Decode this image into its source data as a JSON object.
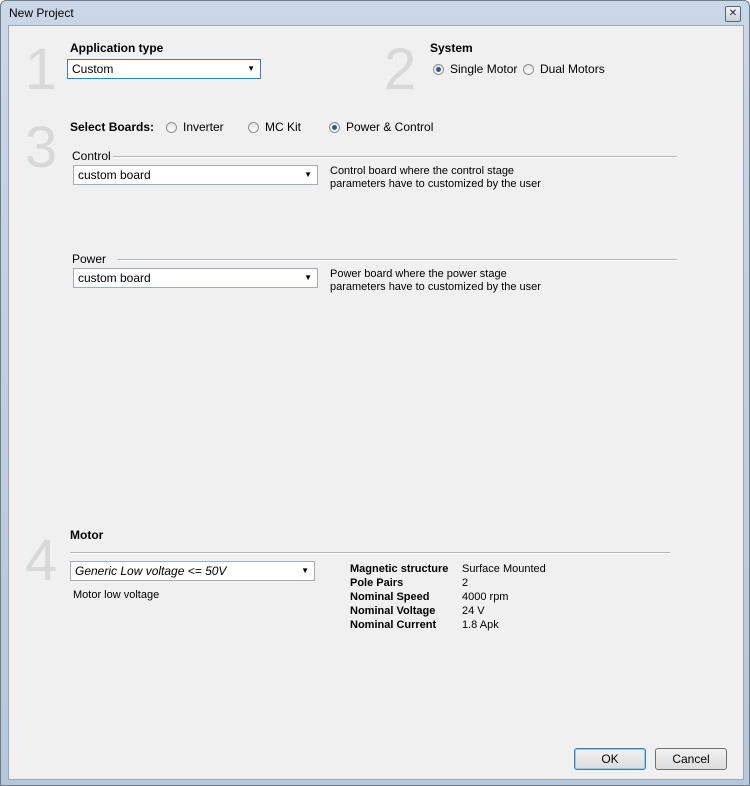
{
  "window": {
    "title": "New Project",
    "close_glyph": "✕"
  },
  "step_numbers": [
    "1",
    "2",
    "3",
    "4"
  ],
  "application_type": {
    "label": "Application type",
    "selected": "Custom"
  },
  "system": {
    "label": "System",
    "options": [
      {
        "label": "Single Motor",
        "selected": true
      },
      {
        "label": "Dual Motors",
        "selected": false
      }
    ]
  },
  "boards": {
    "label": "Select Boards:",
    "options": [
      {
        "label": "Inverter",
        "selected": false
      },
      {
        "label": "MC Kit",
        "selected": false
      },
      {
        "label": "Power & Control",
        "selected": true
      }
    ],
    "control": {
      "label": "Control",
      "selected": "custom board",
      "description_line1": "Control board where the control stage",
      "description_line2": "parameters have to customized by the user"
    },
    "power": {
      "label": "Power",
      "selected": "custom board",
      "description_line1": "Power board where the power stage",
      "description_line2": "parameters have to customized by the user"
    }
  },
  "motor": {
    "label": "Motor",
    "selected": "Generic Low voltage <= 50V",
    "description": "Motor low voltage",
    "properties": [
      {
        "key": "Magnetic structure",
        "value": "Surface Mounted"
      },
      {
        "key": "Pole Pairs",
        "value": "2"
      },
      {
        "key": "Nominal Speed",
        "value": "4000 rpm"
      },
      {
        "key": "Nominal Voltage",
        "value": "24 V"
      },
      {
        "key": "Nominal Current",
        "value": "1.8 Apk"
      }
    ]
  },
  "buttons": {
    "ok": "OK",
    "cancel": "Cancel"
  }
}
